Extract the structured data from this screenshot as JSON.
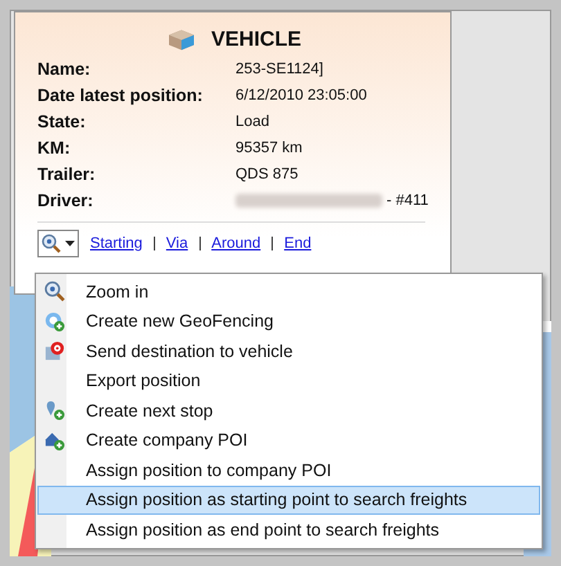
{
  "card": {
    "title": "VEHICLE",
    "fields": [
      {
        "label": "Name:",
        "value": "253-SE1124]"
      },
      {
        "label": "Date latest position:",
        "value": "6/12/2010 23:05:00"
      },
      {
        "label": "State:",
        "value": "Load"
      },
      {
        "label": "KM:",
        "value": "95357 km"
      },
      {
        "label": "Trailer:",
        "value": "QDS 875"
      },
      {
        "label": "Driver:",
        "value": "- #411",
        "redacted": true
      }
    ],
    "links": [
      "Starting",
      "Via",
      "Around",
      "End"
    ]
  },
  "menu": [
    {
      "label": "Zoom in",
      "kind": "zoom",
      "selected": false
    },
    {
      "label": "Create new GeoFencing",
      "kind": "geofence",
      "selected": false
    },
    {
      "label": "Send destination to vehicle",
      "kind": "destination",
      "selected": false
    },
    {
      "label": "Export position",
      "kind": "plain",
      "selected": false
    },
    {
      "label": "Create next stop",
      "kind": "stop",
      "selected": false
    },
    {
      "label": "Create company POI",
      "kind": "poi",
      "selected": false
    },
    {
      "label": "Assign position to company POI",
      "kind": "plain",
      "selected": false
    },
    {
      "label": "Assign position as starting point to search freights",
      "kind": "plain",
      "selected": true
    },
    {
      "label": "Assign position as end point to search freights",
      "kind": "plain",
      "selected": false
    }
  ]
}
